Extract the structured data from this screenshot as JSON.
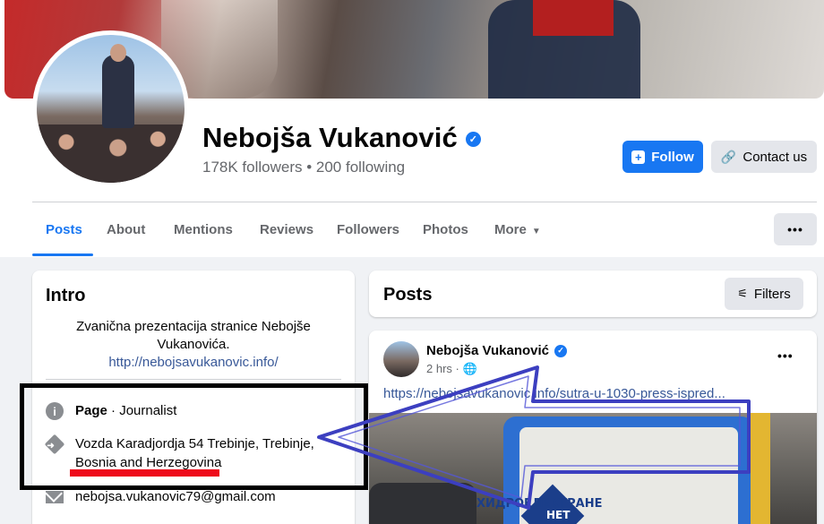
{
  "profile": {
    "name": "Nebojša Vukanović",
    "verified_mark": "✓",
    "stats": "178K followers • 200 following"
  },
  "actions": {
    "follow_label": "Follow",
    "contact_label": "Contact us"
  },
  "tabs": [
    {
      "label": "Posts",
      "active": true
    },
    {
      "label": "About"
    },
    {
      "label": "Mentions"
    },
    {
      "label": "Reviews"
    },
    {
      "label": "Followers"
    },
    {
      "label": "Photos"
    },
    {
      "label": "More"
    }
  ],
  "intro": {
    "title": "Intro",
    "bio": "Zvanična prezentacija stranice Nebojše Vukanovića.",
    "link": "http://nebojsavukanovic.info/",
    "page_label": "Page",
    "page_category": " · Journalist",
    "address": "Vozda Karadjordja 54 Trebinje, Trebinje, Bosnia and Herzegovina",
    "email": "nebojsa.vukanovic79@gmail.com"
  },
  "posts": {
    "title": "Posts",
    "filters_label": "Filters",
    "post": {
      "author": "Nebojša Vukanović",
      "time": "2 hrs ·",
      "link": "https://nebojsavukanovic.info/sutra-u-1030-press-ispred...",
      "image_sign_text": "ХИДРОЕЛЕКТРАНЕ",
      "image_sign_badge": "НЕТ"
    }
  },
  "colors": {
    "accent": "#1877f2",
    "annotation_box": "#000000",
    "annotation_underline": "#ee0a1b",
    "annotation_arrow": "#3c3fc0"
  }
}
